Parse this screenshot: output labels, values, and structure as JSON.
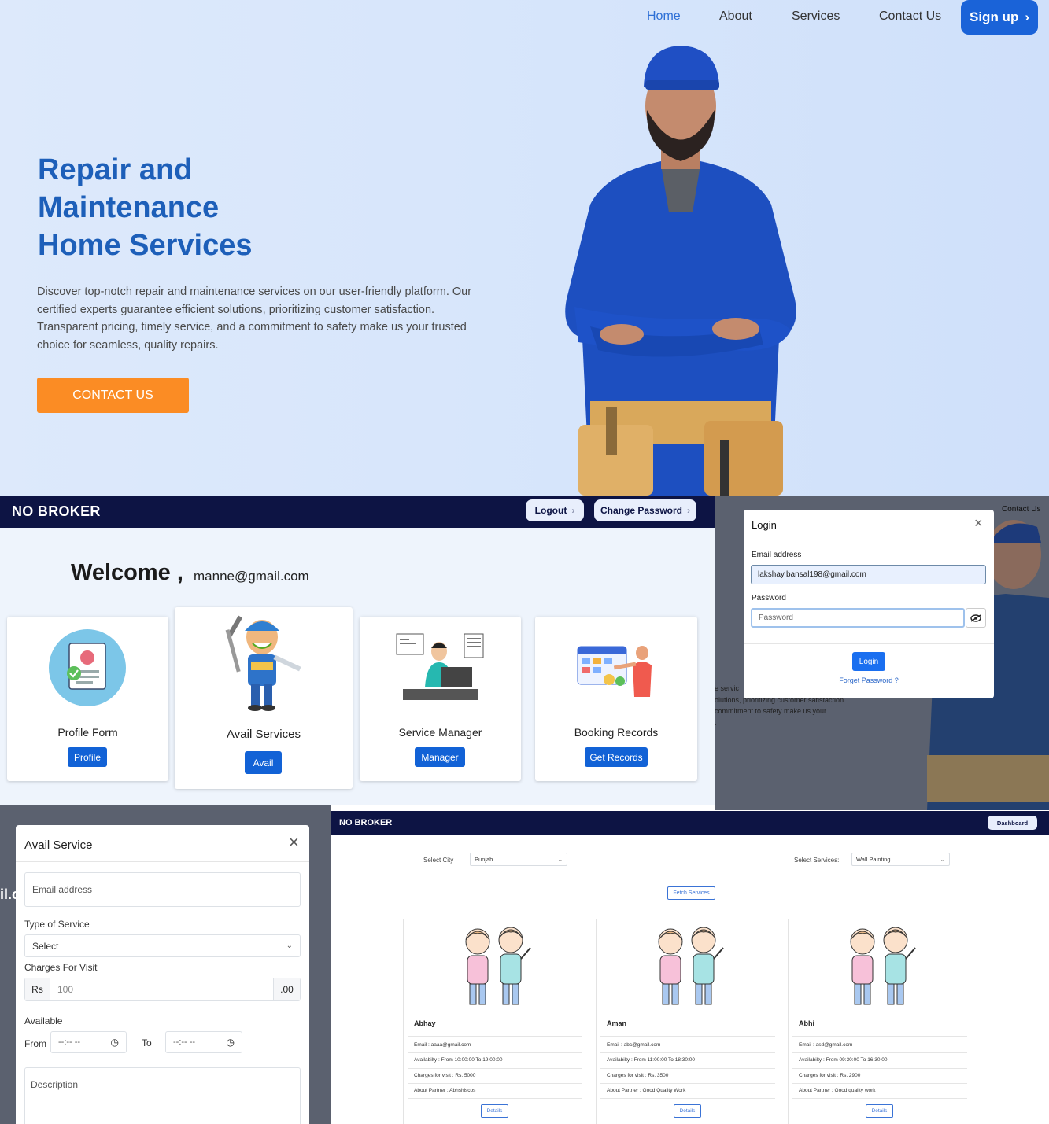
{
  "hero": {
    "nav": [
      "Home",
      "About",
      "Services",
      "Contact Us"
    ],
    "signup_label": "Sign up",
    "title_lines": [
      "Repair and",
      "Maintenance",
      "Home Services"
    ],
    "description": "Discover top-notch repair and maintenance services on our user-friendly platform. Our certified experts guarantee efficient solutions, prioritizing customer satisfaction. Transparent pricing, timely service, and a commitment to safety make us your trusted choice for seamless, quality repairs.",
    "contact_label": "CONTACT US"
  },
  "dashboard": {
    "brand": "NO BROKER",
    "logout_label": "Logout",
    "change_password_label": "Change Password",
    "welcome": "Welcome ,",
    "user_email": "manne@gmail.com",
    "cards": [
      {
        "title": "Profile Form",
        "button": "Profile"
      },
      {
        "title": "Avail Services",
        "button": "Avail"
      },
      {
        "title": "Service Manager",
        "button": "Manager"
      },
      {
        "title": "Booking Records",
        "button": "Get Records"
      }
    ]
  },
  "login": {
    "title": "Login",
    "email_label": "Email address",
    "email_value": "lakshay.bansal198@gmail.com",
    "password_label": "Password",
    "password_placeholder": "Password",
    "login_button": "Login",
    "forgot_link": "Forget Password ?",
    "bg_contact": "Contact Us",
    "bg_text": "e servic\nolutions, prioritizing customer satisfaction.\ncommitment to safety make us your\n."
  },
  "avail_service": {
    "title": "Avail Service",
    "email_placeholder": "Email address",
    "type_label": "Type of Service",
    "type_value": "Select",
    "charges_label": "Charges For Visit",
    "currency": "Rs",
    "charges_placeholder": "100",
    "decimals": ".00",
    "available_label": "Available",
    "from_label": "From",
    "to_label": "To",
    "time_placeholder": "--:-- --",
    "description_placeholder": "Description",
    "bg_text": "il.c"
  },
  "services_page": {
    "brand": "NO BROKER",
    "dashboard_label": "Dashboard",
    "city_label": "Select City :",
    "city_value": "Punjab",
    "service_label": "Select Services:",
    "service_value": "Wall Painting",
    "fetch_label": "Fetch Services",
    "details_label": "Details",
    "partners": [
      {
        "name": "Abhay",
        "email": "Email : aaaa@gmail.com",
        "availability": "Availabilty : From 10:00:00 To 19:00:00",
        "charges": "Charges for visit : Rs. 5000",
        "about": "About Partner : Abhshiscos"
      },
      {
        "name": "Aman",
        "email": "Email : abc@gmail.com",
        "availability": "Availabilty : From 11:00:00 To 18:30:00",
        "charges": "Charges for visit : Rs. 3500",
        "about": "About Partner : Good Quality Work"
      },
      {
        "name": "Abhi",
        "email": "Email : asd@gmail.com",
        "availability": "Availabilty : From 09:30:00 To 16:30:00",
        "charges": "Charges for visit : Rs. 2900",
        "about": "About Partner : Good quality work"
      }
    ]
  },
  "colors": {
    "brand_navy": "#0d1444",
    "primary_blue": "#1262d6",
    "hero_title": "#1d5fb9",
    "contact_orange": "#fb8c24"
  }
}
